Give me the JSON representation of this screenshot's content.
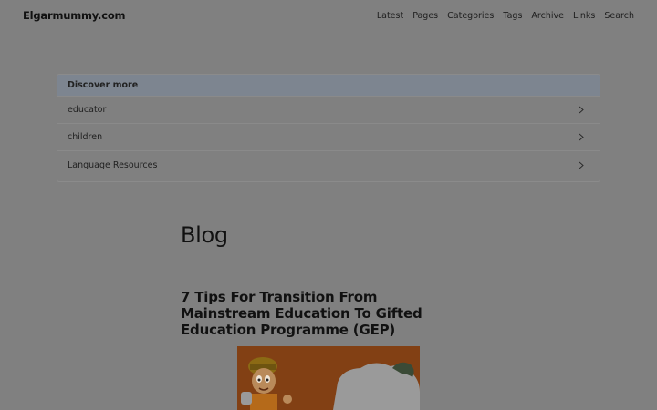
{
  "site": {
    "title": "Elgarmummy.com"
  },
  "nav": {
    "items": [
      "Latest",
      "Pages",
      "Categories",
      "Tags",
      "Archive",
      "Links",
      "Search"
    ]
  },
  "discover": {
    "heading": "Discover more",
    "items": [
      "educator",
      "children",
      "Language Resources"
    ]
  },
  "main": {
    "heading": "Blog",
    "post": {
      "title": "7 Tips For Transition From Mainstream Education To Gifted Education Programme (GEP)"
    }
  },
  "colors": {
    "overlay": "#808080",
    "discover_header": "#7d8590"
  }
}
